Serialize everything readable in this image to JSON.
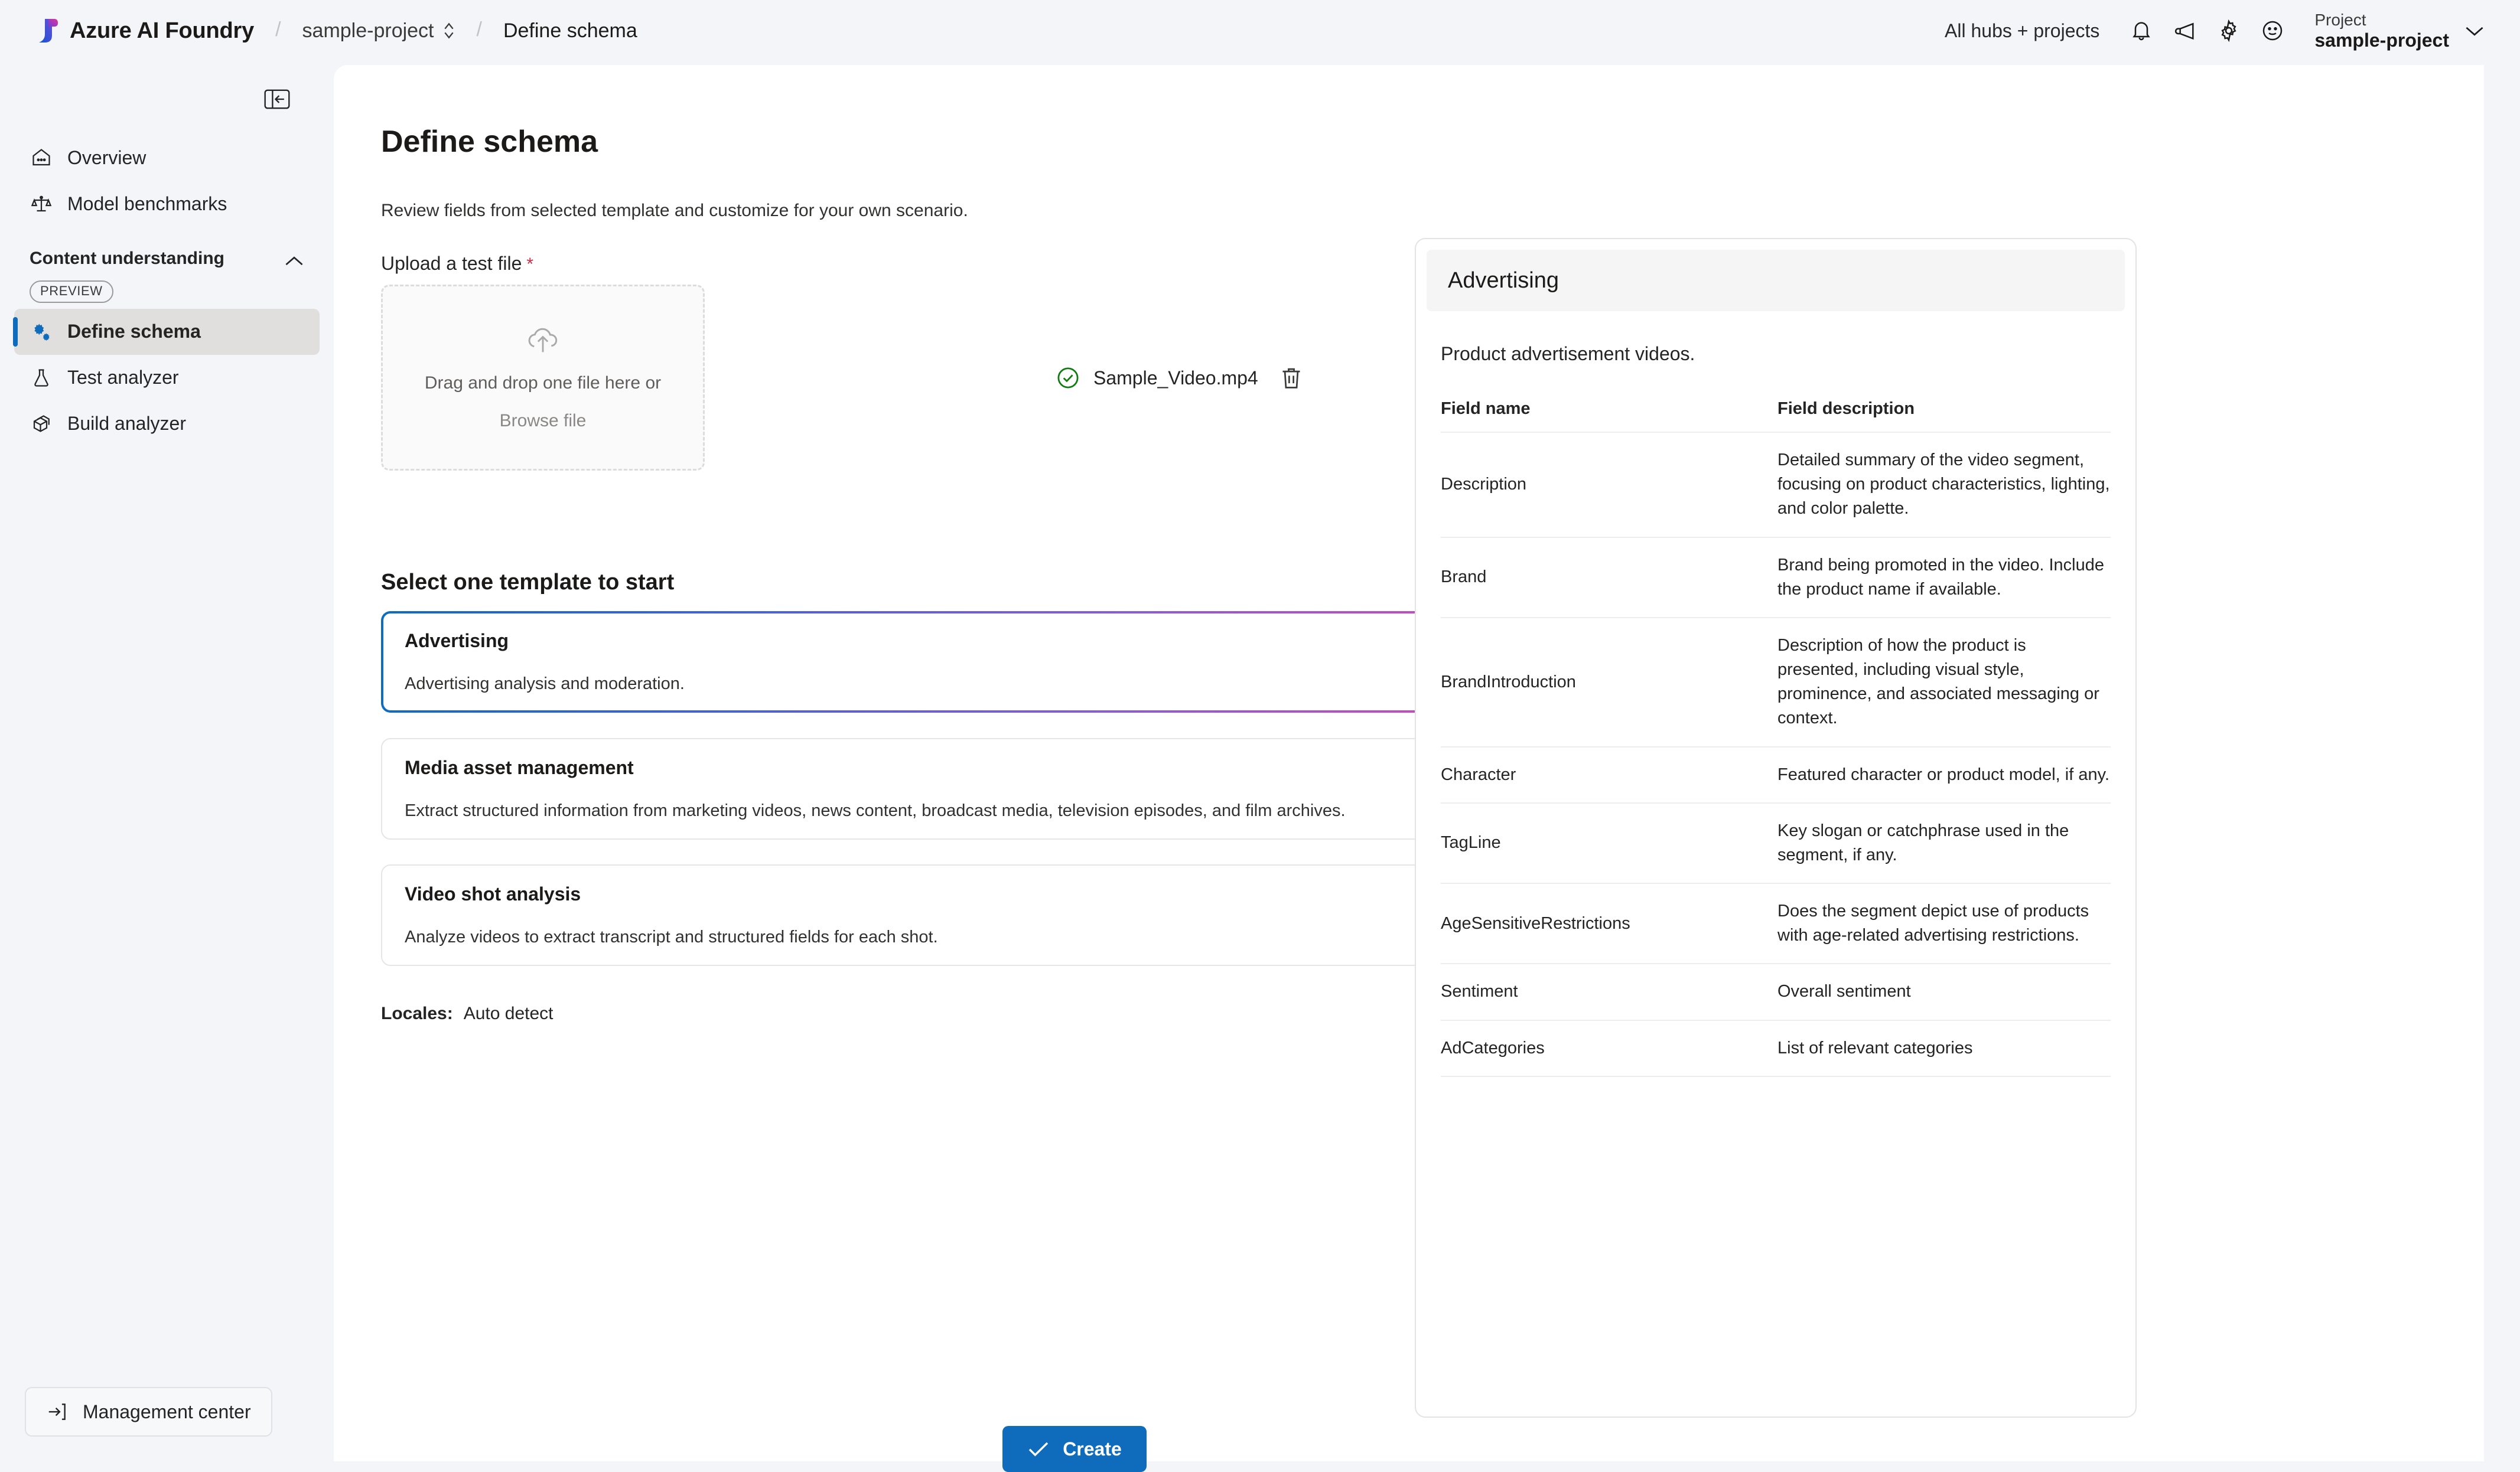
{
  "topbar": {
    "brand": "Azure AI Foundry",
    "breadcrumb_project": "sample-project",
    "breadcrumb_current": "Define schema",
    "hubs_link": "All hubs + projects",
    "icons": [
      "bell-icon",
      "megaphone-icon",
      "gear-icon",
      "feedback-smiley-icon"
    ],
    "project_label": "Project",
    "project_value": "sample-project"
  },
  "sidebar": {
    "collapse_icon": "collapse-panel-icon",
    "items": [
      {
        "label": "Overview",
        "icon": "home-icon"
      },
      {
        "label": "Model benchmarks",
        "icon": "scales-icon"
      }
    ],
    "group": {
      "title": "Content understanding",
      "badge": "PREVIEW",
      "chevron": "chevron-up-icon",
      "items": [
        {
          "label": "Define schema",
          "icon": "schema-gears-icon",
          "active": true
        },
        {
          "label": "Test analyzer",
          "icon": "flask-icon",
          "active": false
        },
        {
          "label": "Build analyzer",
          "icon": "cube-icon",
          "active": false
        }
      ]
    },
    "management_center": "Management center"
  },
  "main": {
    "title": "Define schema",
    "subtitle": "Review fields from selected template and customize for your own scenario.",
    "upload_label": "Upload a test file",
    "required_mark": "*",
    "dropzone": {
      "icon": "cloud-upload-icon",
      "line1": "Drag and drop one file here or",
      "line2": "Browse file"
    },
    "uploaded_file": {
      "status_icon": "checkmark-circle-icon",
      "name": "Sample_Video.mp4",
      "delete_icon": "trash-icon"
    },
    "template_heading": "Select one template to start",
    "templates": [
      {
        "title": "Advertising",
        "description": "Advertising analysis and moderation.",
        "selected": true
      },
      {
        "title": "Media asset management",
        "description": "Extract structured information from marketing videos, news content, broadcast media, television episodes, and film archives.",
        "selected": false
      },
      {
        "title": "Video shot analysis",
        "description": "Analyze videos to extract transcript and structured fields for each shot.",
        "selected": false
      }
    ],
    "locales_label": "Locales:",
    "locales_value": "Auto detect",
    "create_button": "Create",
    "create_icon": "checkmark-icon",
    "splitter": "panel-resize-handle"
  },
  "right_panel": {
    "header_title": "Advertising",
    "description": "Product advertisement videos.",
    "columns": [
      "Field name",
      "Field description"
    ],
    "rows": [
      {
        "name": "Description",
        "desc": "Detailed summary of the video segment, focusing on product characteristics, lighting, and color palette."
      },
      {
        "name": "Brand",
        "desc": "Brand being promoted in the video. Include the product name if available."
      },
      {
        "name": "BrandIntroduction",
        "desc": "Description of how the product is presented, including visual style, prominence, and associated messaging or context."
      },
      {
        "name": "Character",
        "desc": "Featured character or product model, if any."
      },
      {
        "name": "TagLine",
        "desc": "Key slogan or catchphrase used in the segment, if any."
      },
      {
        "name": "AgeSensitiveRestrictions",
        "desc": "Does the segment depict use of products with age-related advertising restrictions."
      },
      {
        "name": "Sentiment",
        "desc": "Overall sentiment"
      },
      {
        "name": "AdCategories",
        "desc": "List of relevant categories"
      }
    ]
  },
  "colors": {
    "accent": "#0f6cbd",
    "app_bg": "#f3f5f8",
    "panel_bg": "#ffffff",
    "nav_active_bg": "#e1dfdd",
    "required_red": "#c4314b",
    "success_green": "#107c10",
    "gradient_start": "#0f6cbd",
    "gradient_mid": "#8b5cd6",
    "gradient_end": "#e0389f"
  }
}
